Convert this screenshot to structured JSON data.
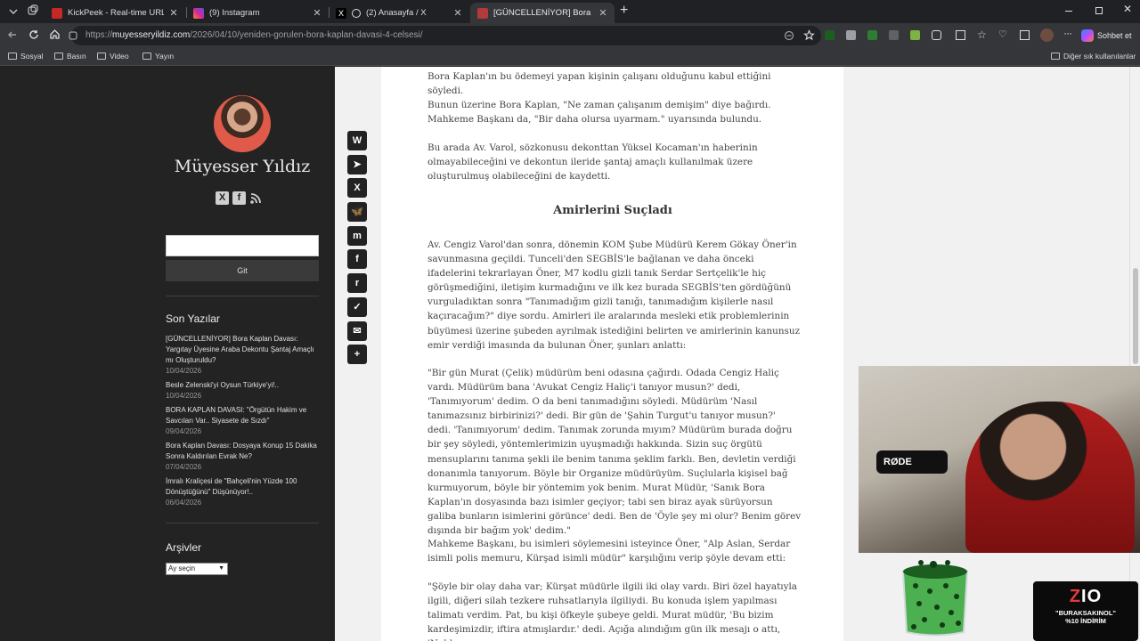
{
  "browser": {
    "tabs": [
      {
        "title": "KickPeek - Real-time URL Crawler",
        "active": false,
        "favicon_color": "#c62828"
      },
      {
        "title": "(9) Instagram",
        "active": false,
        "favicon_color": "#d6249f"
      },
      {
        "title": "(2) Anasayfa / X",
        "active": false,
        "favicon_color": "#000000"
      },
      {
        "title": "[GÜNCELLENİYOR] Bora Kaplan Da",
        "active": true,
        "favicon_color": "#b23a3a"
      }
    ],
    "url_prefix": "https://",
    "url_host": "muyesseryildiz.com",
    "url_path": "/2026/04/10/yeniden-gorulen-bora-kaplan-davasi-4-celsesi/",
    "chat_button": "Sohbet et",
    "bookmarks": [
      "Sosyal",
      "Basın",
      "Video",
      "Yayın"
    ],
    "other_bookmarks": "Diğer sık kullanılanlar"
  },
  "sidebar": {
    "site_title": "Müyesser Yıldız",
    "search_button": "Git",
    "recent_heading": "Son Yazılar",
    "recent_posts": [
      {
        "title": "[GÜNCELLENİYOR] Bora Kaplan Davası: Yargıtay Üyesine Araba Dekontu Şantaj Amaçlı mı Oluşturuldu?",
        "date": "10/04/2026"
      },
      {
        "title": "Besle Zelenski'yi Oysun Türkiye'yi!..",
        "date": "10/04/2026"
      },
      {
        "title": "BORA KAPLAN DAVASI: \"Örgütün Hakim ve Savcıları Var.. Siyasete de Sızdı\"",
        "date": "09/04/2026"
      },
      {
        "title": "Bora Kaplan Davası: Dosyaya Konup 15 Dakika Sonra Kaldırılan Evrak Ne?",
        "date": "07/04/2026"
      },
      {
        "title": "İmralı Kraliçesi de \"Bahçeli'nin Yüzde 100 Dönüştüğünü\" Düşünüyor!..",
        "date": "06/04/2026"
      }
    ],
    "archive_heading": "Arşivler",
    "archive_select": "Ay seçin"
  },
  "share_icons": [
    "whatsapp-icon",
    "telegram-icon",
    "x-icon",
    "bluesky-icon",
    "mastodon-icon",
    "facebook-icon",
    "reddit-icon",
    "pocket-icon",
    "email-icon",
    "add-more-icon"
  ],
  "article": {
    "p1": "Bora Kaplan'ın bu ödemeyi yapan kişinin çalışanı olduğunu kabul ettiğini söyledi.",
    "p2": "Bunun üzerine Bora Kaplan, \"Ne zaman çalışanım demişim\" diye bağırdı. Mahkeme Başkanı da, \"Bir daha olursa uyarmam.\" uyarısında bulundu.",
    "p3": "Bu arada Av. Varol, sözkonusu dekonttan Yüksel Kocaman'ın haberinin olmayabileceğini ve dekontun ileride şantaj amaçlı kullanılmak üzere oluşturulmuş olabileceğini de kaydetti.",
    "heading": "Amirlerini Suçladı",
    "p4": "Av. Cengiz Varol'dan sonra, dönemin KOM Şube Müdürü Kerem Gökay Öner'in savunmasına geçildi. Tunceli'den SEGBİS'le bağlanan ve daha önceki ifadelerini tekrarlayan Öner, M7 kodlu gizli tanık Serdar Sertçelik'le hiç görüşmediğini, iletişim kurmadığını ve ilk kez burada SEGBİS'ten gördüğünü vurguladıktan sonra \"Tanımadığım gizli tanığı, tanımadığım kişilerle nasıl kaçıracağım?\" diye sordu. Amirleri ile aralarında mesleki etik problemlerinin büyümesi üzerine şubeden ayrılmak istediğini belirten ve amirlerinin kanunsuz emir verdiği imasında da bulunan Öner, şunları anlattı:",
    "p5": "\"Bir gün Murat (Çelik) müdürüm beni odasına çağırdı. Odada Cengiz Haliç vardı. Müdürüm bana 'Avukat Cengiz Haliç'i tanıyor musun?' dedi, 'Tanımıyorum' dedim. O da beni tanımadığını söyledi. Müdürüm 'Nasıl tanımazsınız birbirinizi?' dedi. Bir gün de 'Şahin Turgut'u tanıyor musun?' dedi. 'Tanımıyorum' dedim. Tanımak zorunda mıyım? Müdürüm burada doğru bir şey söyledi, yöntemlerimizin uyuşmadığı hakkında. Sizin suç örgütü mensuplarını tanıma şekli ile benim tanıma şeklim farklı. Ben, devletin verdiği donanımla tanıyorum. Böyle bir Organize müdürüyüm. Suçlularla kişisel bağ kurmuyorum, böyle bir yöntemim yok benim. Murat Müdür, 'Sanık Bora Kaplan'ın dosyasında bazı isimler geçiyor; tabi sen biraz ayak sürüyorsun galiba bunların isimlerini görünce' dedi. Ben de 'Öyle şey mi olur? Benim görev dışında bir bağım yok' dedim.\"",
    "p6": "Mahkeme Başkanı, bu isimleri söylemesini isteyince Öner, \"Alp Aslan, Serdar isimli polis memuru, Kürşad isimli müdür\" karşılığını verip şöyle devam etti:",
    "p7": "\"Şöyle bir olay daha var; Kürşat müdürle ilgili iki olay vardı. Biri özel hayatıyla ilgili, diğeri silah tezkere ruhsatlarıyla ilgiliydi. Bu konuda işlem yapılması talimatı verdim. Pat, bu kişi öfkeyle şubeye geldi. Murat müdür, 'Bu bizim kardeşimizdir, iftira atmışlardır.' dedi. Açığa alındığım gün ilk mesajı o attı, 'Noldu"
  },
  "overlay": {
    "mic_brand": "RØDE",
    "promo_logo_z": "Z",
    "promo_logo_rest": "IO",
    "promo_line1": "\"BURAKSAKINOL\"",
    "promo_line2": "%10 İNDİRİM"
  }
}
